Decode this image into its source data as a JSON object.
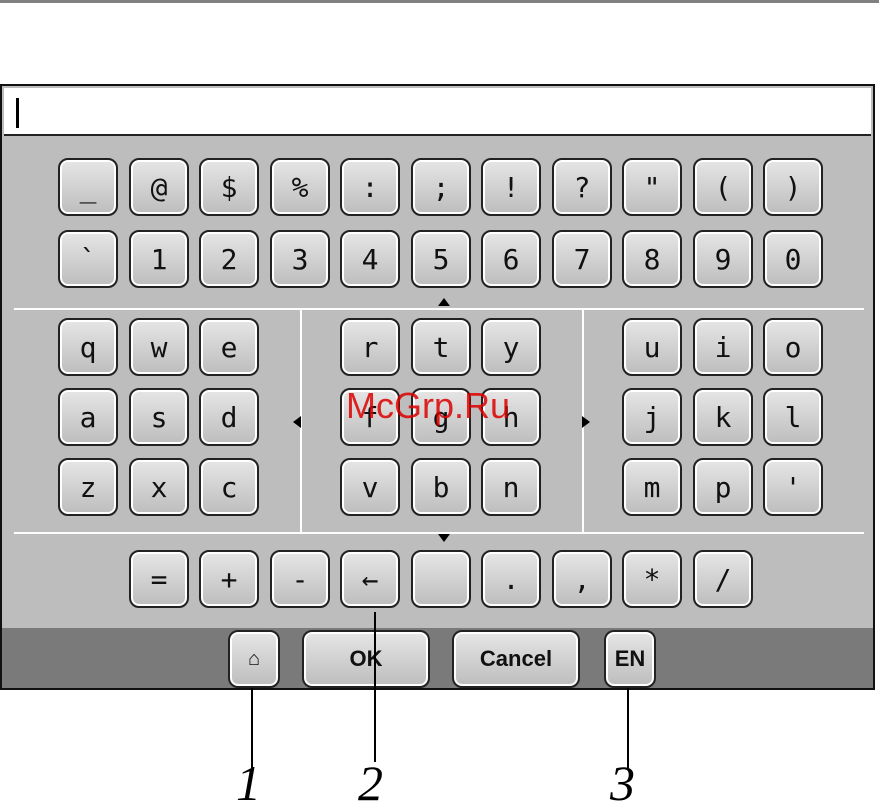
{
  "keyboard": {
    "row_symbols": [
      "_",
      "@",
      "$",
      "%",
      ":",
      ";",
      "!",
      "?",
      "\"",
      "(",
      ")"
    ],
    "row_numbers": [
      "`",
      "1",
      "2",
      "3",
      "4",
      "5",
      "6",
      "7",
      "8",
      "9",
      "0"
    ],
    "letters_left": [
      [
        "q",
        "w",
        "e"
      ],
      [
        "a",
        "s",
        "d"
      ],
      [
        "z",
        "x",
        "c"
      ]
    ],
    "letters_mid": [
      [
        "r",
        "t",
        "y"
      ],
      [
        "f",
        "g",
        "h"
      ],
      [
        "v",
        "b",
        "n"
      ]
    ],
    "letters_right": [
      [
        "u",
        "i",
        "o"
      ],
      [
        "j",
        "k",
        "l"
      ],
      [
        "m",
        "p",
        "'"
      ]
    ],
    "row_bottom": [
      "=",
      "+",
      "-",
      "←",
      "",
      ".",
      ",",
      "*",
      "/"
    ]
  },
  "buttons": {
    "shift_icon": "⌂",
    "ok": "OK",
    "cancel": "Cancel",
    "lang": "EN"
  },
  "callouts": [
    "1",
    "2",
    "3"
  ],
  "watermark": "McGrp.Ru"
}
